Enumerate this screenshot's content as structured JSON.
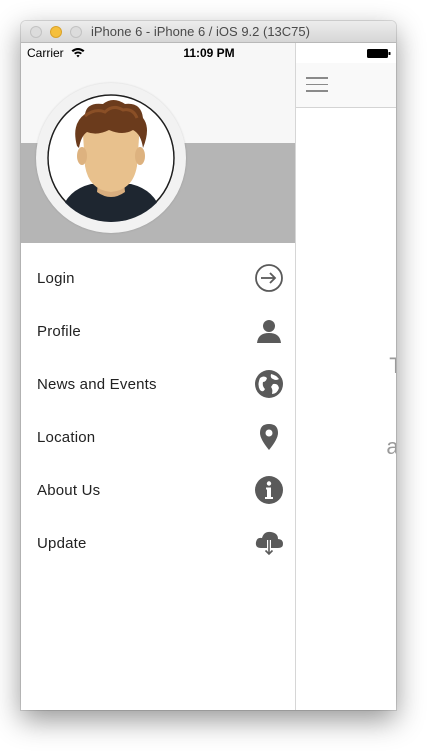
{
  "window": {
    "title": "iPhone 6 - iPhone 6 / iOS 9.2 (13C75)"
  },
  "statusbar": {
    "carrier": "Carrier",
    "time": "11:09 PM"
  },
  "menu": {
    "items": [
      {
        "label": "Login",
        "icon": "login-icon"
      },
      {
        "label": "Profile",
        "icon": "user-icon"
      },
      {
        "label": "News and Events",
        "icon": "globe-icon"
      },
      {
        "label": "Location",
        "icon": "location-pin-icon"
      },
      {
        "label": "About Us",
        "icon": "info-icon"
      },
      {
        "label": "Update",
        "icon": "cloud-download-icon"
      }
    ]
  },
  "main": {
    "lines": [
      "This is",
      "and will",
      "a"
    ]
  },
  "colors": {
    "icon": "#5a5a5a",
    "band": "#b5b5b5",
    "text": "#222222",
    "placeholder": "#9a9a9a"
  }
}
